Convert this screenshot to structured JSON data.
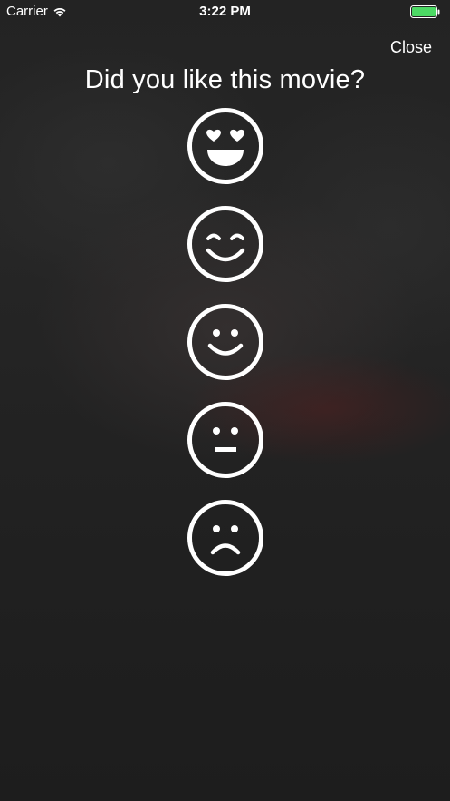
{
  "status_bar": {
    "carrier": "Carrier",
    "time": "3:22 PM",
    "wifi_icon": "wifi-icon",
    "battery_icon": "battery-icon",
    "battery_color": "#4cd964"
  },
  "close_label": "Close",
  "question": "Did you like this movie?",
  "ratings": [
    {
      "icon": "heart-eyes-face-icon"
    },
    {
      "icon": "happy-closed-eyes-face-icon"
    },
    {
      "icon": "smiling-face-icon"
    },
    {
      "icon": "neutral-face-icon"
    },
    {
      "icon": "sad-face-icon"
    }
  ],
  "colors": {
    "foreground": "#ffffff",
    "background": "#222222"
  }
}
